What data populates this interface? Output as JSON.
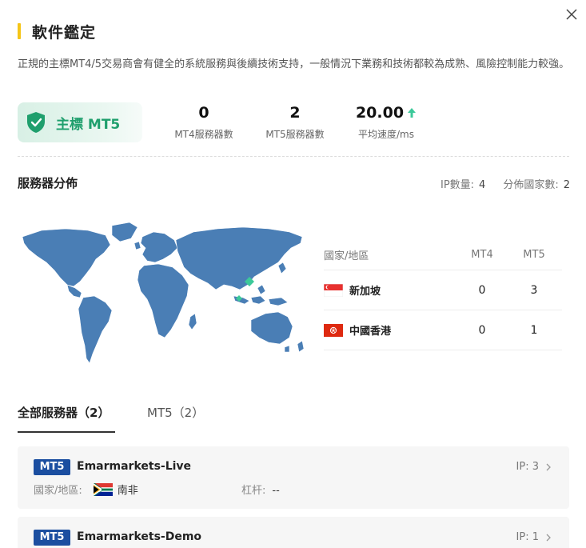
{
  "header": {
    "title": "軟件鑑定",
    "description": "正規的主標MT4/5交易商會有健全的系統服務與後續技術支持，一般情況下業務和技術都較為成熟、風險控制能力較強。"
  },
  "grade": {
    "label": "主標 MT5",
    "color": "#1f9f6d"
  },
  "stats": [
    {
      "value": "0",
      "label": "MT4服務器數"
    },
    {
      "value": "2",
      "label": "MT5服務器數"
    },
    {
      "value": "20.00",
      "label": "平均速度/ms"
    }
  ],
  "distribution": {
    "title": "服務器分佈",
    "ip_label": "IP數量:",
    "ip_value": "4",
    "country_label": "分佈國家數:",
    "country_value": "2",
    "map_color": "#4a7eb5",
    "marker_color": "#3cc99a"
  },
  "country_table": {
    "headers": [
      "國家/地區",
      "MT4",
      "MT5"
    ],
    "rows": [
      {
        "name": "新加坡",
        "flag": "singapore-flag",
        "mt4": "0",
        "mt5": "3"
      },
      {
        "name": "中國香港",
        "flag": "hongkong-flag",
        "mt4": "0",
        "mt5": "1"
      }
    ]
  },
  "tabs": [
    {
      "label": "全部服務器（2）",
      "active": true
    },
    {
      "label": "MT5（2）",
      "active": false
    }
  ],
  "servers": [
    {
      "tag": "MT5",
      "name": "Emarmarkets-Live",
      "ip": "IP:  3",
      "country_label": "國家/地區:",
      "country": "南非",
      "flag": "south-africa-flag",
      "leverage_label": "杠杆:",
      "leverage": "--"
    },
    {
      "tag": "MT5",
      "name": "Emarmarkets-Demo",
      "ip": "IP:  1"
    }
  ],
  "colors": {
    "accent": "#f5c518",
    "tag_blue": "#1b4ea0",
    "green": "#1f9f6d"
  }
}
